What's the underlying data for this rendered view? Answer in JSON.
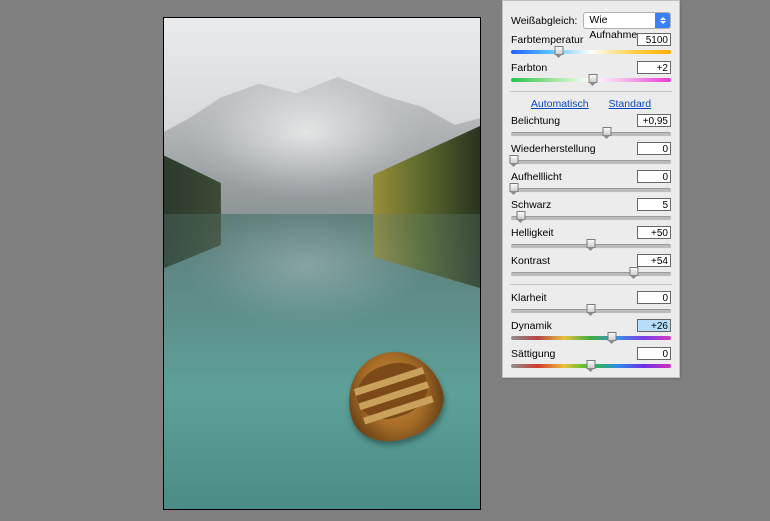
{
  "whitebalance": {
    "label": "Weißabgleich:",
    "selected": "Wie Aufnahme"
  },
  "auto_link": "Automatisch",
  "standard_link": "Standard",
  "sliders": {
    "temperature": {
      "label": "Farbtemperatur",
      "value": "5100",
      "pos": 30
    },
    "tint": {
      "label": "Farbton",
      "value": "+2",
      "pos": 51
    },
    "exposure": {
      "label": "Belichtung",
      "value": "+0,95",
      "pos": 60
    },
    "recovery": {
      "label": "Wiederherstellung",
      "value": "0",
      "pos": 2
    },
    "filllight": {
      "label": "Aufhelllicht",
      "value": "0",
      "pos": 2
    },
    "black": {
      "label": "Schwarz",
      "value": "5",
      "pos": 6
    },
    "brightness": {
      "label": "Helligkeit",
      "value": "+50",
      "pos": 50
    },
    "contrast": {
      "label": "Kontrast",
      "value": "+54",
      "pos": 77
    },
    "clarity": {
      "label": "Klarheit",
      "value": "0",
      "pos": 50
    },
    "vibrance": {
      "label": "Dynamik",
      "value": "+26",
      "pos": 63,
      "highlight": true
    },
    "saturation": {
      "label": "Sättigung",
      "value": "0",
      "pos": 50
    }
  }
}
